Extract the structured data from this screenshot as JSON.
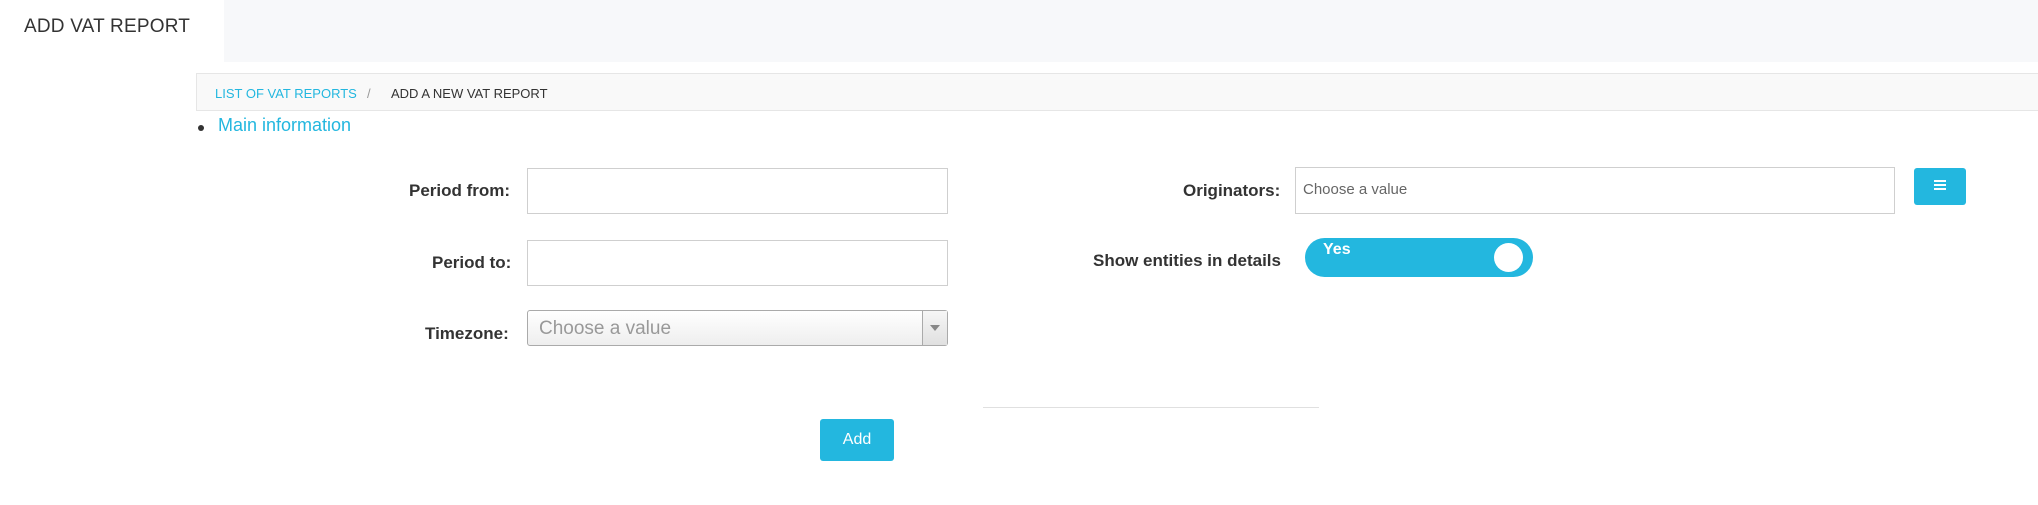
{
  "header": {
    "title": "ADD VAT REPORT"
  },
  "breadcrumb": {
    "items": [
      "LIST OF VAT REPORTS",
      "ADD A NEW VAT REPORT"
    ],
    "separator": "/"
  },
  "section_tabs": [
    {
      "label": "Main information"
    }
  ],
  "form": {
    "period_from": {
      "label": "Period from:",
      "value": ""
    },
    "period_to": {
      "label": "Period to:",
      "value": ""
    },
    "timezone": {
      "label": "Timezone:",
      "placeholder": "Choose a value"
    },
    "originators": {
      "label": "Originators:",
      "placeholder": "Choose a value"
    },
    "show_entities": {
      "label": "Show entities in details",
      "value": "Yes"
    }
  },
  "actions": {
    "add_label": "Add"
  },
  "colors": {
    "accent": "#23b7df",
    "topbar_bg": "#f7f8fa",
    "breadcrumb_bg": "#f9f9f9"
  },
  "icons": {
    "originators_button": "list-icon",
    "timezone_dropdown": "caret-down-icon"
  }
}
